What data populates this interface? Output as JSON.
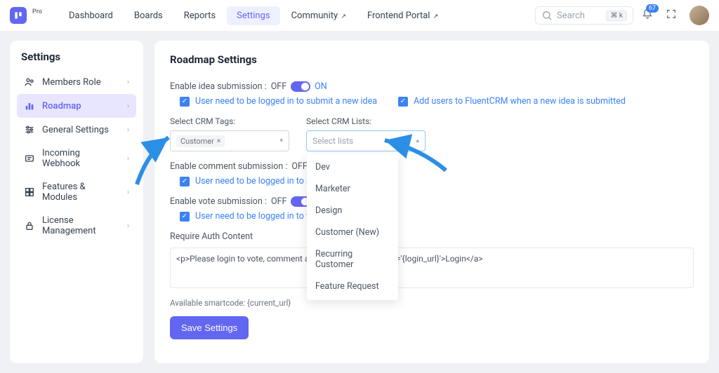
{
  "topbar": {
    "pro": "Pro",
    "nav": [
      "Dashboard",
      "Boards",
      "Reports",
      "Settings",
      "Community",
      "Frontend Portal"
    ],
    "search_placeholder": "Search",
    "kbd": "⌘ k",
    "notif_count": "67"
  },
  "sidebar": {
    "title": "Settings",
    "items": [
      {
        "label": "Members Role"
      },
      {
        "label": "Roadmap"
      },
      {
        "label": "General Settings"
      },
      {
        "label": "Incoming Webhook"
      },
      {
        "label": "Features & Modules"
      },
      {
        "label": "License Management"
      }
    ]
  },
  "main": {
    "title": "Roadmap Settings",
    "idea_label": "Enable idea submission :",
    "off": "OFF",
    "on": "ON",
    "idea_cb1": "User need to be logged in to submit a new idea",
    "idea_cb2": "Add users to FluentCRM when a new idea is submitted",
    "tags_label": "Select CRM Tags:",
    "tags_value": "Customer",
    "lists_label": "Select CRM Lists:",
    "lists_placeholder": "Select lists",
    "lists_options": [
      "Dev",
      "Marketer",
      "Design",
      "Customer (New)",
      "Recurring Customer",
      "Feature Request"
    ],
    "comment_label": "Enable comment submission :",
    "comment_cb": "User need to be logged in to add",
    "vote_label": "Enable vote submission :",
    "vote_cb": "User need to be logged in to vote",
    "auth_label": "Require Auth Content",
    "auth_value": "<p>Please login to vote, comment and                                     ='{login_url}'>Login</a>",
    "smartcode": "Available smartcode: {current_url}",
    "save": "Save Settings"
  }
}
